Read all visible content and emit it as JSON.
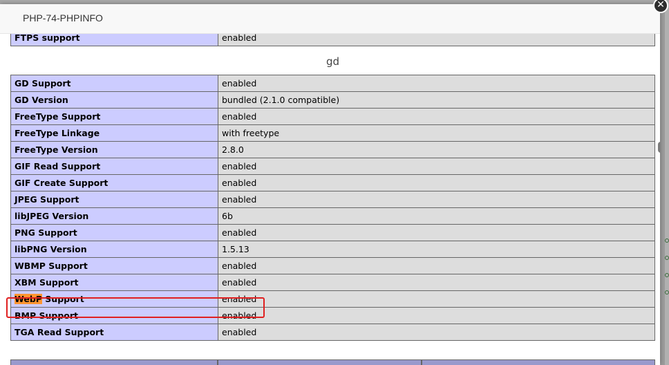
{
  "dialog": {
    "title": "PHP-74-PHPINFO",
    "close_icon": "close-icon"
  },
  "top_row": {
    "name": "FTPS support",
    "value": "enabled"
  },
  "section": {
    "title": "gd",
    "rows": [
      {
        "name": "GD Support",
        "value": "enabled"
      },
      {
        "name": "GD Version",
        "value": "bundled (2.1.0 compatible)"
      },
      {
        "name": "FreeType Support",
        "value": "enabled"
      },
      {
        "name": "FreeType Linkage",
        "value": "with freetype"
      },
      {
        "name": "FreeType Version",
        "value": "2.8.0"
      },
      {
        "name": "GIF Read Support",
        "value": "enabled"
      },
      {
        "name": "GIF Create Support",
        "value": "enabled"
      },
      {
        "name": "JPEG Support",
        "value": "enabled"
      },
      {
        "name": "libJPEG Version",
        "value": "6b"
      },
      {
        "name": "PNG Support",
        "value": "enabled"
      },
      {
        "name": "libPNG Version",
        "value": "1.5.13"
      },
      {
        "name": "WBMP Support",
        "value": "enabled"
      },
      {
        "name": "XBM Support",
        "value": "enabled"
      },
      {
        "name_highlight": "WebP",
        "name_rest": " Support",
        "value": "enabled"
      },
      {
        "name": "BMP Support",
        "value": "enabled"
      },
      {
        "name": "TGA Read Support",
        "value": "enabled"
      }
    ]
  },
  "colors": {
    "name_cell": "#ccccff",
    "value_cell": "#dddddd",
    "search_highlight": "#ff9632",
    "annotation_box": "#e02020"
  }
}
